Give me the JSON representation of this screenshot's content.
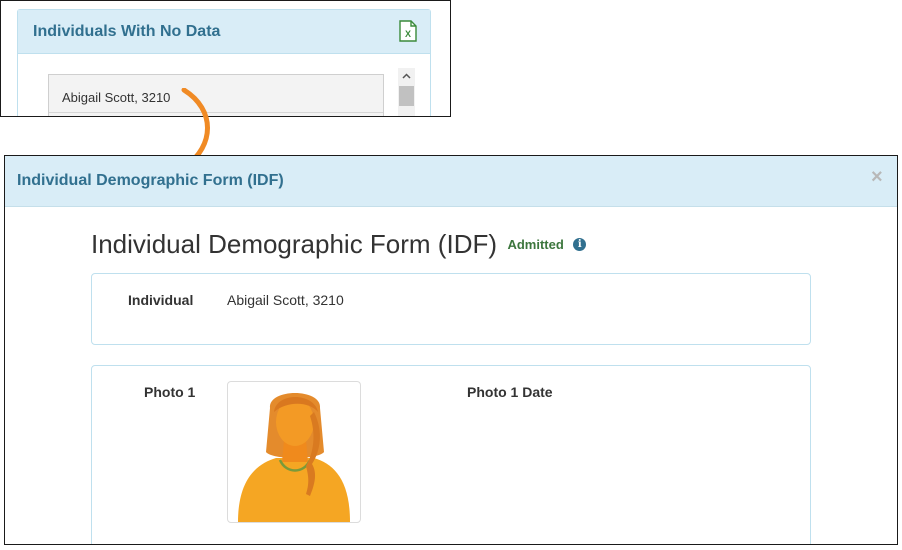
{
  "no_data_panel": {
    "title": "Individuals With No Data",
    "export_icon": "excel-icon",
    "items": [
      {
        "label": "Abigail Scott, 3210"
      }
    ]
  },
  "modal": {
    "title": "Individual Demographic Form (IDF)",
    "close_label": "×",
    "form_title": "Individual Demographic Form (IDF)",
    "status": "Admitted",
    "info_icon": "info-icon",
    "individual": {
      "label": "Individual",
      "value": "Abigail Scott, 3210"
    },
    "photo": {
      "label": "Photo 1",
      "date_label": "Photo 1 Date",
      "image_icon": "person-photo"
    }
  },
  "colors": {
    "header_bg": "#d9edf7",
    "header_text": "#31708f",
    "status_green": "#3c763d",
    "arrow": "#f08a24",
    "card_border": "#bfe0ee"
  }
}
